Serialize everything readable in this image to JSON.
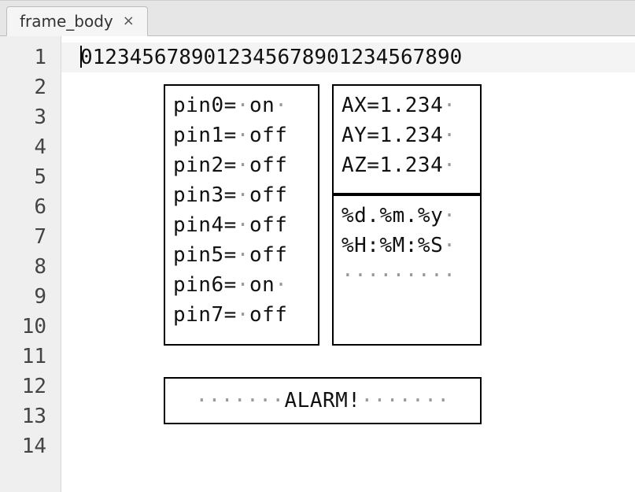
{
  "tab": {
    "title": "frame_body",
    "close_glyph": "×"
  },
  "lines": {
    "count": 14
  },
  "ruler": "0123456789012345678901234567890",
  "pins": [
    "pin0=·on·",
    "pin1=·off",
    "pin2=·off",
    "pin3=·off",
    "pin4=·off",
    "pin5=·off",
    "pin6=·on·",
    "pin7=·off"
  ],
  "accel": [
    "AX=1.234·",
    "AY=1.234·",
    "AZ=1.234·"
  ],
  "clock": [
    "%d.%m.%y·",
    "%H:%M:%S·",
    "·········"
  ],
  "alarm": "·······ALARM!·······"
}
